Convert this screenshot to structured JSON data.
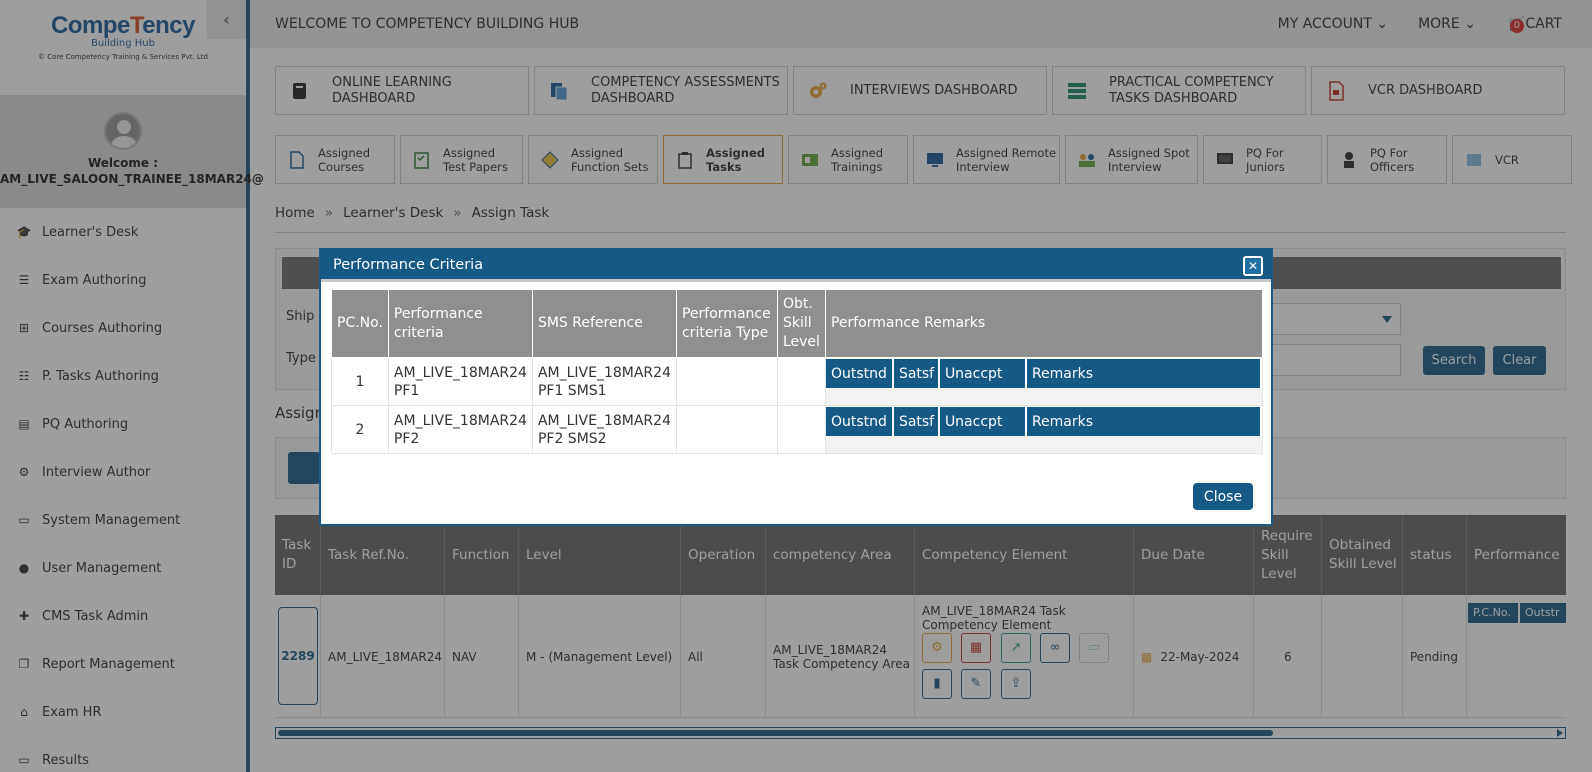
{
  "sidebar": {
    "logo": {
      "title_part1": "Compe",
      "title_part2": "T",
      "title_part3": "ency",
      "subtitle": "Building Hub",
      "caption": "© Core Competency Training & Services Pvt. Ltd"
    },
    "welcome_label": "Welcome :",
    "username": "AM_LIVE_SALOON_TRAINEE_18MAR24@",
    "items": [
      {
        "label": "Learner's Desk",
        "icon": "graduation-cap-icon"
      },
      {
        "label": "Exam Authoring",
        "icon": "list-icon"
      },
      {
        "label": "Courses Authoring",
        "icon": "sitemap-icon"
      },
      {
        "label": "P. Tasks Authoring",
        "icon": "tasks-icon"
      },
      {
        "label": "PQ Authoring",
        "icon": "book-icon"
      },
      {
        "label": "Interview Author",
        "icon": "cogs-icon"
      },
      {
        "label": "System Management",
        "icon": "desktop-icon"
      },
      {
        "label": "User Management",
        "icon": "user-icon"
      },
      {
        "label": "CMS Task Admin",
        "icon": "user-plus-icon"
      },
      {
        "label": "Report Management",
        "icon": "copy-icon"
      },
      {
        "label": "Exam HR",
        "icon": "bank-icon"
      },
      {
        "label": "Results",
        "icon": "monitor-icon"
      }
    ]
  },
  "topbar": {
    "title": "WELCOME TO COMPETENCY BUILDING HUB",
    "my_account": "MY ACCOUNT",
    "more": "MORE",
    "cart": "CART",
    "cart_count": "0"
  },
  "dashboards": [
    {
      "line1": "ONLINE LEARNING",
      "line2": "DASHBOARD"
    },
    {
      "line1": "COMPETENCY ASSESSMENTS",
      "line2": "DASHBOARD"
    },
    {
      "line1": "INTERVIEWS DASHBOARD",
      "line2": ""
    },
    {
      "line1": "PRACTICAL COMPETENCY",
      "line2": "TASKS DASHBOARD"
    },
    {
      "line1": "VCR DASHBOARD",
      "line2": ""
    }
  ],
  "subtabs": [
    {
      "line1": "Assigned",
      "line2": "Courses"
    },
    {
      "line1": "Assigned",
      "line2": "Test Papers"
    },
    {
      "line1": "Assigned",
      "line2": "Function Sets"
    },
    {
      "line1": "Assigned",
      "line2": "Tasks"
    },
    {
      "line1": "Assigned",
      "line2": "Trainings"
    },
    {
      "line1": "Assigned Remote",
      "line2": "Interview"
    },
    {
      "line1": "Assigned Spot",
      "line2": "Interview"
    },
    {
      "line1": "PQ For",
      "line2": "Juniors"
    },
    {
      "line1": "PQ For",
      "line2": "Officers"
    },
    {
      "line1": "VCR",
      "line2": ""
    }
  ],
  "breadcrumb": {
    "home": "Home",
    "desk": "Learner's Desk",
    "current": "Assign Task",
    "sep": "»"
  },
  "search": {
    "label1": "Ship",
    "label2": "Type",
    "search_btn": "Search",
    "clear_btn": "Clear",
    "section_title": "Assign"
  },
  "task_table": {
    "headers": [
      "Task ID",
      "Task Ref.No.",
      "Function",
      "Level",
      "Operation",
      "competency Area",
      "Competency Element",
      "Due Date",
      "Require Skill Level",
      "Obtained Skill Level",
      "status",
      "Performance"
    ],
    "row": {
      "task_id": "2289",
      "ref": "AM_LIVE_18MAR24",
      "function": "NAV",
      "level": "M - (Management Level)",
      "operation": "All",
      "area": "AM_LIVE_18MAR24 Task Competency Area",
      "element": "AM_LIVE_18MAR24 Task Competency Element",
      "due_date": "22-May-2024",
      "require": "6",
      "obtained": "",
      "status": "Pending",
      "perf_mini": [
        "P.C.No.",
        "Outstr"
      ]
    }
  },
  "modal": {
    "title": "Performance Criteria",
    "close_label": "Close",
    "headers": {
      "pcno": "PC.No.",
      "criteria": "Performance criteria",
      "sms": "SMS Reference",
      "type": "Performance criteria Type",
      "obt": "Obt. Skill Level",
      "remarks": "Performance Remarks"
    },
    "remark_cols": [
      "Outstnd",
      "Satsf",
      "Unaccpt",
      "Remarks"
    ],
    "rows": [
      {
        "no": "1",
        "criteria_1": "AM_LIVE_18MAR24",
        "criteria_2": "PF1",
        "sms_1": "AM_LIVE_18MAR24",
        "sms_2": "PF1 SMS1",
        "type": "",
        "obt": ""
      },
      {
        "no": "2",
        "criteria_1": "AM_LIVE_18MAR24",
        "criteria_2": "PF2",
        "sms_1": "AM_LIVE_18MAR24",
        "sms_2": "PF2 SMS2",
        "type": "",
        "obt": ""
      }
    ]
  },
  "colors": {
    "brand": "#155a86",
    "accent": "#d9542b",
    "active_tab_border": "#e8a33d"
  }
}
